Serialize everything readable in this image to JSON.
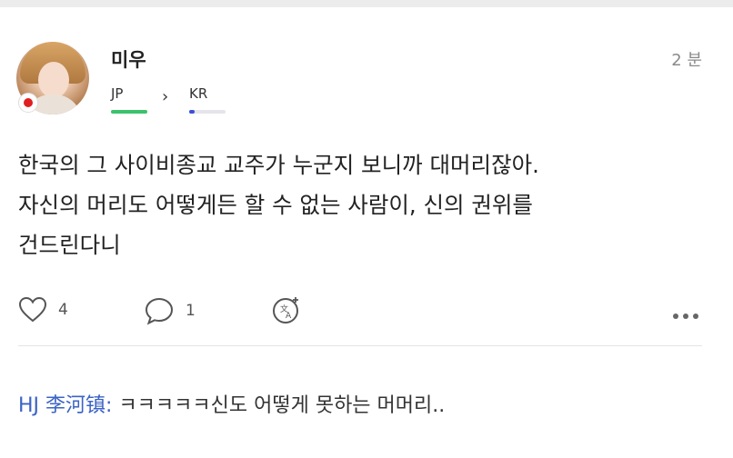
{
  "post": {
    "username": "미우",
    "time": "2 분",
    "language_from": "JP",
    "language_to": "KR",
    "language_from_level": 1.0,
    "language_to_level": 0.15,
    "body_lines": [
      "한국의 그 사이비종교 교주가 누군지 보니까 대머리잖아.",
      "자신의 머리도 어떻게든 할 수 없는 사람이,  신의 권위를",
      "건드린다니"
    ],
    "likes": "4",
    "comments": "1",
    "colors": {
      "native_bar": "#3cc26b",
      "learning_bar": "#3b4fd6",
      "reply_author": "#3b63c4"
    }
  },
  "reply": {
    "author": "HJ 李河镇:",
    "text": "ㅋㅋㅋㅋㅋ신도 어떻게 못하는 머머리.."
  },
  "icons": [
    "heart-icon",
    "comment-icon",
    "translate-icon",
    "more-icon",
    "flag-japan-icon"
  ]
}
